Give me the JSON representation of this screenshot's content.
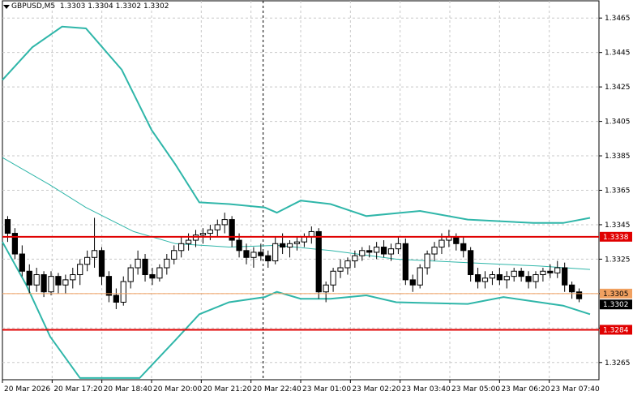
{
  "header": {
    "symbol": "GBPUSD,M5",
    "ohlc": "1.3303 1.3304 1.3302 1.3302"
  },
  "colors": {
    "background": "#ffffff",
    "grid": "#c8c8c8",
    "band": "#2fb6a9",
    "support_resistance": "#e00000",
    "bid_line": "#f0a060",
    "candle": "#000000"
  },
  "chart_data": {
    "type": "candlestick",
    "symbol": "GBPUSD",
    "timeframe": "M5",
    "ylim": [
      1.3255,
      1.3475
    ],
    "y_ticks": [
      "1.3465",
      "1.3445",
      "1.3425",
      "1.3405",
      "1.3385",
      "1.3365",
      "1.3345",
      "1.3325",
      "1.3305",
      "1.3285",
      "1.3265"
    ],
    "x_ticks": [
      "20 Mar 2026",
      "20 Mar 17:20",
      "20 Mar 18:40",
      "20 Mar 20:00",
      "20 Mar 21:20",
      "20 Mar 22:40",
      "23 Mar 01:00",
      "23 Mar 02:20",
      "23 Mar 03:40",
      "23 Mar 05:00",
      "23 Mar 06:20",
      "23 Mar 07:40"
    ],
    "grid": true,
    "horizontal_levels": [
      {
        "price": 1.3338,
        "label": "1.3338"
      },
      {
        "price": 1.3284,
        "label": "1.3284"
      }
    ],
    "bid": {
      "price": 1.3305,
      "label": "1.3305"
    },
    "current_price": {
      "price": 1.3302,
      "label": "1.3302"
    },
    "separator_at_tick": "20 Mar 22:40",
    "candles": [
      [
        1.3348,
        1.335,
        1.3335,
        1.334
      ],
      [
        1.334,
        1.3343,
        1.3325,
        1.3328
      ],
      [
        1.3328,
        1.3333,
        1.3315,
        1.3318
      ],
      [
        1.3318,
        1.3322,
        1.3305,
        1.331
      ],
      [
        1.331,
        1.332,
        1.3306,
        1.3316
      ],
      [
        1.3316,
        1.3318,
        1.3303,
        1.3306
      ],
      [
        1.3306,
        1.3318,
        1.3304,
        1.3315
      ],
      [
        1.3315,
        1.3317,
        1.3305,
        1.331
      ],
      [
        1.331,
        1.3316,
        1.3305,
        1.3313
      ],
      [
        1.3313,
        1.332,
        1.3308,
        1.3316
      ],
      [
        1.3316,
        1.3325,
        1.331,
        1.3322
      ],
      [
        1.3322,
        1.333,
        1.3318,
        1.3326
      ],
      [
        1.3326,
        1.3349,
        1.332,
        1.333
      ],
      [
        1.333,
        1.3332,
        1.331,
        1.3315
      ],
      [
        1.3315,
        1.3318,
        1.33,
        1.3304
      ],
      [
        1.3304,
        1.3308,
        1.3296,
        1.33
      ],
      [
        1.33,
        1.3315,
        1.3298,
        1.3312
      ],
      [
        1.3312,
        1.3322,
        1.3308,
        1.332
      ],
      [
        1.332,
        1.333,
        1.3316,
        1.3325
      ],
      [
        1.3325,
        1.3328,
        1.3312,
        1.3316
      ],
      [
        1.3316,
        1.332,
        1.331,
        1.3314
      ],
      [
        1.3314,
        1.3322,
        1.3312,
        1.332
      ],
      [
        1.332,
        1.3328,
        1.3316,
        1.3325
      ],
      [
        1.3325,
        1.3333,
        1.3322,
        1.333
      ],
      [
        1.333,
        1.3338,
        1.3326,
        1.3334
      ],
      [
        1.3334,
        1.334,
        1.333,
        1.3336
      ],
      [
        1.3336,
        1.3342,
        1.3332,
        1.3339
      ],
      [
        1.3339,
        1.3343,
        1.3334,
        1.334
      ],
      [
        1.334,
        1.3345,
        1.3336,
        1.3342
      ],
      [
        1.3342,
        1.3348,
        1.3338,
        1.3345
      ],
      [
        1.3345,
        1.3352,
        1.334,
        1.3348
      ],
      [
        1.3348,
        1.335,
        1.3332,
        1.3336
      ],
      [
        1.3336,
        1.334,
        1.3326,
        1.333
      ],
      [
        1.333,
        1.3334,
        1.3322,
        1.3326
      ],
      [
        1.3326,
        1.3332,
        1.332,
        1.3329
      ],
      [
        1.3329,
        1.3334,
        1.3324,
        1.3327
      ],
      [
        1.3327,
        1.333,
        1.332,
        1.3324
      ],
      [
        1.3324,
        1.3338,
        1.3322,
        1.3334
      ],
      [
        1.3334,
        1.334,
        1.3328,
        1.3332
      ],
      [
        1.3332,
        1.3336,
        1.3326,
        1.3334
      ],
      [
        1.3334,
        1.3338,
        1.333,
        1.3335
      ],
      [
        1.3335,
        1.334,
        1.3332,
        1.3338
      ],
      [
        1.3338,
        1.3344,
        1.3334,
        1.3341
      ],
      [
        1.3341,
        1.3343,
        1.3302,
        1.3306
      ],
      [
        1.3306,
        1.3312,
        1.33,
        1.331
      ],
      [
        1.331,
        1.332,
        1.3306,
        1.3318
      ],
      [
        1.3318,
        1.3325,
        1.3314,
        1.332
      ],
      [
        1.332,
        1.3326,
        1.3316,
        1.3324
      ],
      [
        1.3324,
        1.333,
        1.332,
        1.3327
      ],
      [
        1.3327,
        1.3332,
        1.3324,
        1.333
      ],
      [
        1.333,
        1.3333,
        1.3326,
        1.3329
      ],
      [
        1.3329,
        1.3335,
        1.3325,
        1.3332
      ],
      [
        1.3332,
        1.3336,
        1.3326,
        1.3328
      ],
      [
        1.3328,
        1.3334,
        1.3324,
        1.3331
      ],
      [
        1.3331,
        1.3338,
        1.3328,
        1.3334
      ],
      [
        1.3334,
        1.3337,
        1.331,
        1.3313
      ],
      [
        1.3313,
        1.3316,
        1.3306,
        1.331
      ],
      [
        1.331,
        1.3322,
        1.3308,
        1.332
      ],
      [
        1.332,
        1.333,
        1.3316,
        1.3328
      ],
      [
        1.3328,
        1.3335,
        1.3324,
        1.3332
      ],
      [
        1.3332,
        1.334,
        1.3328,
        1.3336
      ],
      [
        1.3336,
        1.3342,
        1.3332,
        1.3338
      ],
      [
        1.3338,
        1.334,
        1.333,
        1.3334
      ],
      [
        1.3334,
        1.3338,
        1.3326,
        1.333
      ],
      [
        1.333,
        1.3332,
        1.3312,
        1.3316
      ],
      [
        1.3316,
        1.332,
        1.3308,
        1.3312
      ],
      [
        1.3312,
        1.3318,
        1.3308,
        1.3314
      ],
      [
        1.3314,
        1.3318,
        1.331,
        1.3316
      ],
      [
        1.3316,
        1.332,
        1.331,
        1.3313
      ],
      [
        1.3313,
        1.3318,
        1.3308,
        1.3315
      ],
      [
        1.3315,
        1.332,
        1.3312,
        1.3318
      ],
      [
        1.3318,
        1.332,
        1.3312,
        1.3315
      ],
      [
        1.3315,
        1.3318,
        1.3308,
        1.3312
      ],
      [
        1.3312,
        1.3318,
        1.3308,
        1.3316
      ],
      [
        1.3316,
        1.332,
        1.3312,
        1.3318
      ],
      [
        1.3318,
        1.3322,
        1.3314,
        1.3317
      ],
      [
        1.3317,
        1.3324,
        1.3314,
        1.332
      ],
      [
        1.332,
        1.3323,
        1.3306,
        1.331
      ],
      [
        1.331,
        1.3312,
        1.3302,
        1.3306
      ],
      [
        1.3306,
        1.3308,
        1.33,
        1.3302
      ]
    ],
    "bands": {
      "upper": [
        [
          0,
          1.3429
        ],
        [
          0.05,
          1.3448
        ],
        [
          0.1,
          1.346
        ],
        [
          0.14,
          1.3459
        ],
        [
          0.2,
          1.3435
        ],
        [
          0.25,
          1.34
        ],
        [
          0.29,
          1.338
        ],
        [
          0.33,
          1.3358
        ],
        [
          0.38,
          1.3357
        ],
        [
          0.44,
          1.3355
        ],
        [
          0.46,
          1.3352
        ],
        [
          0.5,
          1.3359
        ],
        [
          0.55,
          1.3357
        ],
        [
          0.61,
          1.335
        ],
        [
          0.7,
          1.3353
        ],
        [
          0.78,
          1.3348
        ],
        [
          0.89,
          1.3346
        ],
        [
          0.94,
          1.3346
        ],
        [
          0.985,
          1.3349
        ]
      ],
      "middle": [
        [
          0,
          1.3384
        ],
        [
          0.08,
          1.3368
        ],
        [
          0.14,
          1.3355
        ],
        [
          0.22,
          1.3341
        ],
        [
          0.29,
          1.3334
        ],
        [
          0.38,
          1.3332
        ],
        [
          0.46,
          1.3333
        ],
        [
          0.55,
          1.333
        ],
        [
          0.66,
          1.3325
        ],
        [
          0.78,
          1.3323
        ],
        [
          0.9,
          1.3321
        ],
        [
          0.985,
          1.3319
        ]
      ],
      "lower": [
        [
          0,
          1.3335
        ],
        [
          0.04,
          1.331
        ],
        [
          0.08,
          1.328
        ],
        [
          0.13,
          1.3256
        ],
        [
          0.23,
          1.3256
        ],
        [
          0.29,
          1.3278
        ],
        [
          0.33,
          1.3293
        ],
        [
          0.38,
          1.33
        ],
        [
          0.44,
          1.3303
        ],
        [
          0.46,
          1.3306
        ],
        [
          0.5,
          1.3302
        ],
        [
          0.55,
          1.3302
        ],
        [
          0.61,
          1.3304
        ],
        [
          0.66,
          1.33
        ],
        [
          0.78,
          1.3299
        ],
        [
          0.84,
          1.3303
        ],
        [
          0.9,
          1.33
        ],
        [
          0.94,
          1.3298
        ],
        [
          0.985,
          1.3293
        ]
      ]
    }
  }
}
